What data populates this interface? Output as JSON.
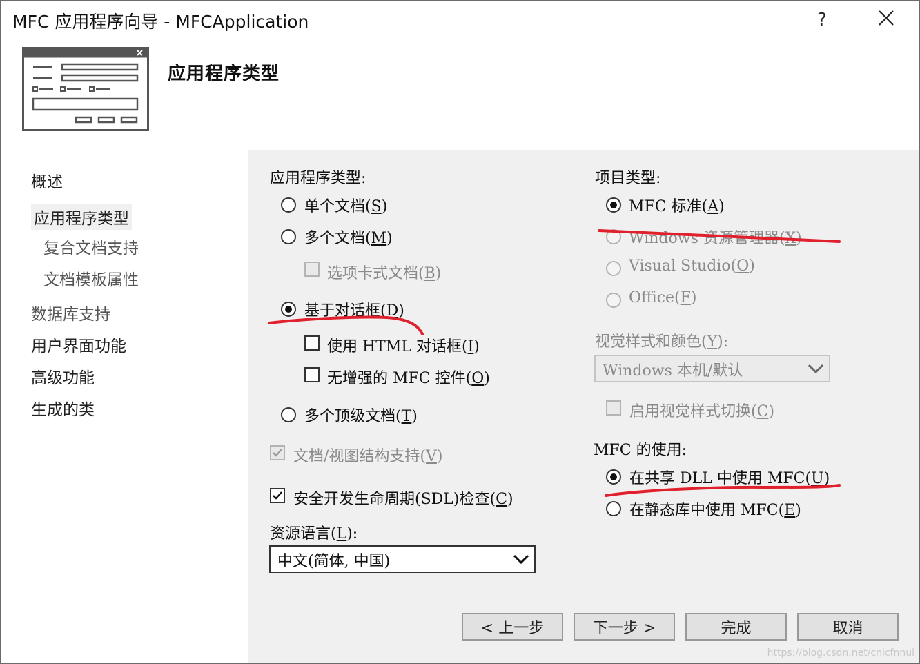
{
  "window": {
    "title": "MFC 应用程序向导 - MFCApplication",
    "help_label": "?",
    "close_label": "✕"
  },
  "header": {
    "title": "应用程序类型"
  },
  "sidebar": {
    "items": [
      {
        "label": "概述"
      },
      {
        "label": "应用程序类型"
      },
      {
        "label": "复合文档支持"
      },
      {
        "label": "文档模板属性"
      },
      {
        "label": "数据库支持"
      },
      {
        "label": "用户界面功能"
      },
      {
        "label": "高级功能"
      },
      {
        "label": "生成的类"
      }
    ]
  },
  "left": {
    "section_label": "应用程序类型:",
    "options": {
      "single": {
        "label": "单个文档",
        "key": "S"
      },
      "multi": {
        "label": "多个文档",
        "key": "M"
      },
      "tabbed": {
        "label": "选项卡式文档",
        "key": "B"
      },
      "dialog": {
        "label": "基于对话框",
        "key": "D"
      },
      "html_dialog": {
        "label": "使用 HTML 对话框",
        "key": "I"
      },
      "no_enhanced": {
        "label": "无增强的 MFC 控件",
        "key": "O"
      },
      "multi_top": {
        "label": "多个顶级文档",
        "key": "T"
      }
    },
    "doc_view": {
      "label": "文档/视图结构支持",
      "key": "V"
    },
    "sdl": {
      "label": "安全开发生命周期(SDL)检查",
      "key": "C"
    },
    "resource_lang": {
      "label": "资源语言",
      "key": "L",
      "value": "中文(简体, 中国)"
    }
  },
  "right": {
    "project_type_label": "项目类型:",
    "options": {
      "mfc_standard": {
        "label": "MFC 标准",
        "key": "A"
      },
      "explorer": {
        "label": "Windows 资源管理器",
        "key": "X"
      },
      "visual_studio": {
        "label": "Visual Studio",
        "key": "O"
      },
      "office": {
        "label": "Office",
        "key": "F"
      }
    },
    "visual_style": {
      "label": "视觉样式和颜色",
      "key": "Y",
      "value": "Windows 本机/默认"
    },
    "style_switch": {
      "label": "启用视觉样式切换",
      "key": "C"
    },
    "mfc_use_label": "MFC 的使用:",
    "mfc_use": {
      "shared": {
        "label": "在共享 DLL 中使用 MFC",
        "key": "U"
      },
      "static": {
        "label": "在静态库中使用 MFC",
        "key": "E"
      }
    }
  },
  "footer": {
    "back": "< 上一步",
    "next": "下一步 >",
    "finish": "完成",
    "cancel": "取消"
  },
  "watermark": "https://blog.csdn.net/cnicfnnui",
  "colors": {
    "annotation": "#e0202c"
  }
}
